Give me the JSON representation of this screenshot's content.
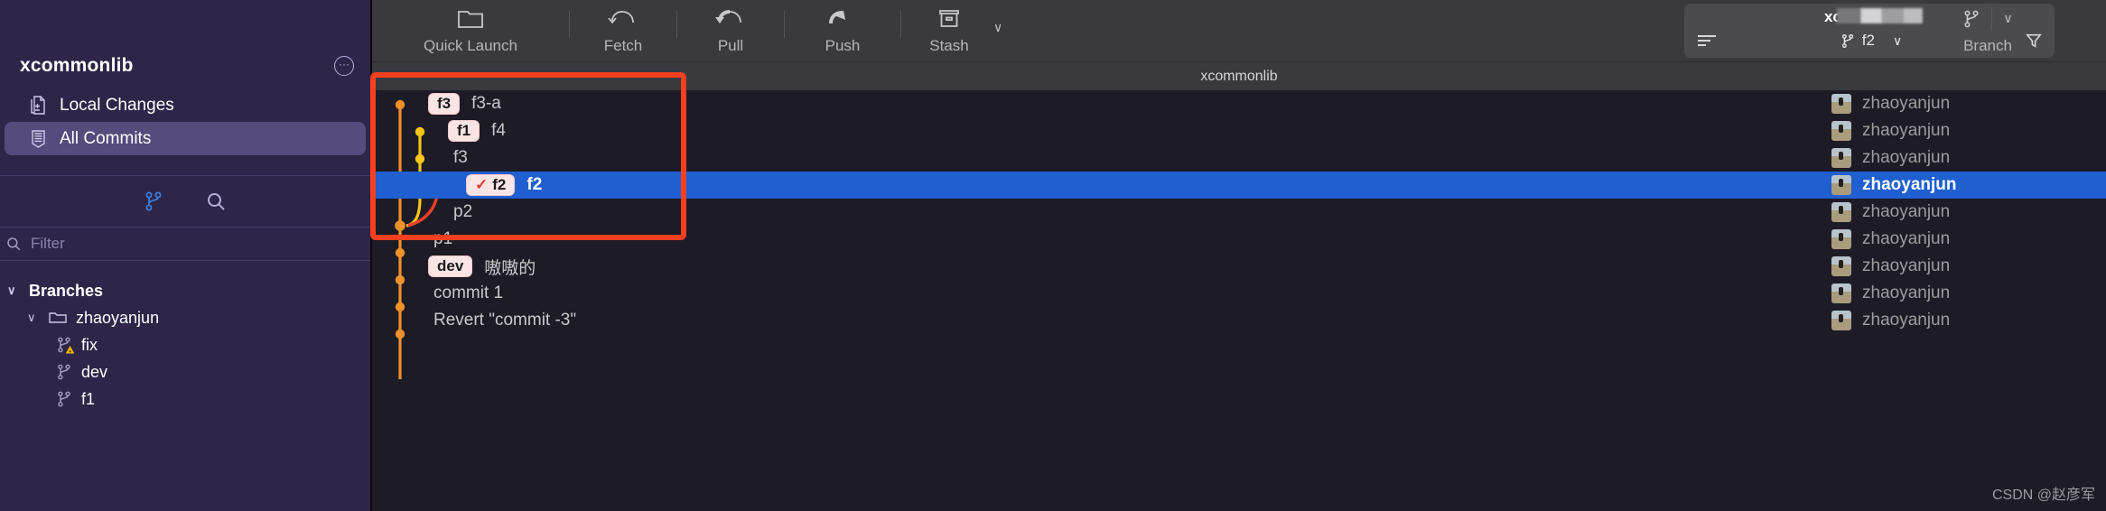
{
  "sidebar": {
    "repo_title": "xcommonlib",
    "more_button": "···",
    "nav": [
      {
        "label": "Local Changes",
        "icon": "file-diff-icon",
        "selected": false
      },
      {
        "label": "All Commits",
        "icon": "commits-icon",
        "selected": true
      }
    ],
    "tools": [
      {
        "name": "branch-icon"
      },
      {
        "name": "search-icon"
      }
    ],
    "filter": {
      "placeholder": "Filter",
      "value": "",
      "icon": "search-icon"
    },
    "tree": [
      {
        "label": "Branches",
        "level": 0,
        "chevron": "∨",
        "icon": null
      },
      {
        "label": "zhaoyanjun",
        "level": 1,
        "chevron": "∨",
        "icon": "folder-icon"
      },
      {
        "label": "fix",
        "level": 2,
        "chevron": "",
        "icon": "branch-warning-icon"
      },
      {
        "label": "dev",
        "level": 2,
        "chevron": "",
        "icon": "branch-icon"
      },
      {
        "label": "f1",
        "level": 2,
        "chevron": "",
        "icon": "branch-icon"
      }
    ]
  },
  "toolbar": {
    "buttons": [
      {
        "label": "Quick Launch",
        "icon": "folder-icon"
      },
      {
        "label": "Fetch",
        "icon": "fetch-arrow-icon"
      },
      {
        "label": "Pull",
        "icon": "pull-arrow-icon"
      },
      {
        "label": "Push",
        "icon": "push-arrow-icon"
      },
      {
        "label": "Stash",
        "icon": "stash-box-icon",
        "caret": "∨"
      }
    ],
    "branch_button": {
      "label": "Branch",
      "icon": "branch-icon",
      "caret": "∨"
    },
    "searchbox": {
      "title": "xcommonlib",
      "branch_value": "f2",
      "branch_icon": "branch-icon",
      "caret": "∨",
      "left_icon": "list-lines-icon",
      "right_icon": "filter-funnel-icon"
    }
  },
  "subheader": {
    "title": "xcommonlib"
  },
  "commits": [
    {
      "tag": "f3",
      "tag_checked": false,
      "message": "f3-a",
      "author": "zhaoyanjun",
      "selected": false
    },
    {
      "tag": "f1",
      "tag_checked": false,
      "message": "f4",
      "author": "zhaoyanjun",
      "selected": false
    },
    {
      "tag": null,
      "tag_checked": false,
      "message": "f3",
      "author": "zhaoyanjun",
      "selected": false
    },
    {
      "tag": "f2",
      "tag_checked": true,
      "message": "f2",
      "author": "zhaoyanjun",
      "selected": true
    },
    {
      "tag": null,
      "tag_checked": false,
      "message": "p2",
      "author": "zhaoyanjun",
      "selected": false
    },
    {
      "tag": null,
      "tag_checked": false,
      "message": "p1",
      "author": "zhaoyanjun",
      "selected": false
    },
    {
      "tag": "dev",
      "tag_checked": false,
      "message": "嗷嗷的",
      "author": "zhaoyanjun",
      "selected": false
    },
    {
      "tag": null,
      "tag_checked": false,
      "message": "commit 1",
      "author": "zhaoyanjun",
      "selected": false
    },
    {
      "tag": null,
      "tag_checked": false,
      "message": "Revert \"commit -3\"",
      "author": "zhaoyanjun",
      "selected": false
    }
  ],
  "annotation": {
    "kind": "red-rectangle-highlight"
  },
  "watermark": "CSDN @赵彦军",
  "colors": {
    "sidebar_bg": "#2e2548",
    "sidebar_selected": "#574a7c",
    "toolbar_bg": "#3a393d",
    "list_bg": "#1d1b26",
    "row_selected": "#1f5fd0",
    "graph_orange": "#f0922a",
    "graph_yellow": "#f5c518",
    "graph_red": "#e8402a",
    "tag_bg": "#fbe4e4",
    "annotation_red": "#f4401f",
    "accent_blue": "#3b7ddd"
  }
}
